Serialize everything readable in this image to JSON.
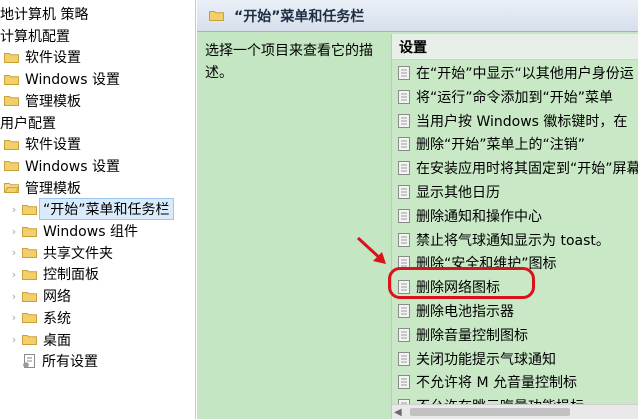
{
  "tree": {
    "items": [
      {
        "label": "地计算机 策略",
        "level": 0,
        "icon": "none"
      },
      {
        "label": "计算机配置",
        "level": 0,
        "icon": "none"
      },
      {
        "label": "软件设置",
        "level": 1,
        "icon": "folder-icon"
      },
      {
        "label": "Windows 设置",
        "level": 1,
        "icon": "folder-icon"
      },
      {
        "label": "管理模板",
        "level": 1,
        "icon": "folder-icon"
      },
      {
        "label": "用户配置",
        "level": 0,
        "icon": "none"
      },
      {
        "label": "软件设置",
        "level": 1,
        "icon": "folder-icon"
      },
      {
        "label": "Windows 设置",
        "level": 1,
        "icon": "folder-icon"
      },
      {
        "label": "管理模板",
        "level": 1,
        "icon": "folder-open-icon"
      },
      {
        "label": "“开始”菜单和任务栏",
        "level": 2,
        "icon": "folder-icon",
        "selected": true
      },
      {
        "label": "Windows 组件",
        "level": 2,
        "icon": "folder-icon"
      },
      {
        "label": "共享文件夹",
        "level": 2,
        "icon": "folder-icon"
      },
      {
        "label": "控制面板",
        "level": 2,
        "icon": "folder-icon"
      },
      {
        "label": "网络",
        "level": 2,
        "icon": "folder-icon"
      },
      {
        "label": "系统",
        "level": 2,
        "icon": "folder-icon"
      },
      {
        "label": "桌面",
        "level": 2,
        "icon": "folder-icon"
      },
      {
        "label": "所有设置",
        "level": 2,
        "icon": "settings-doc-icon"
      }
    ]
  },
  "header": {
    "title": "“开始”菜单和任务栏"
  },
  "description": {
    "text": "选择一个项目来查看它的描述。"
  },
  "list": {
    "column_header": "设置",
    "items": [
      "在“开始”中显示“以其他用户身份运",
      "将“运行”命令添加到“开始”菜单",
      "当用户按 Windows 徽标键时，在",
      "删除“开始”菜单上的“注销”",
      "在安装应用时将其固定到“开始”屏幕",
      "显示其他日历",
      "删除通知和操作中心",
      "禁止将气球通知显示为 toast。",
      "删除“安全和维护”图标",
      "删除网络图标",
      "删除电池指示器",
      "删除音量控制图标",
      "关闭功能提示气球通知",
      "不允许将 M 允音量控制标",
      "不允许在跳元晦量功能损标"
    ],
    "highlighted_index": 9
  },
  "colors": {
    "pane_bg": "#c4e6c2",
    "highlight": "#d9121b",
    "selection": "#d9ebfa"
  }
}
